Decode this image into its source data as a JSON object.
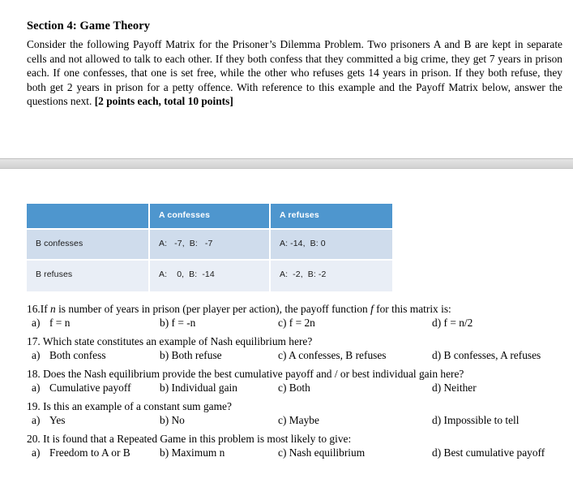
{
  "document": {
    "section_title": "Section 4: Game Theory",
    "intro_paragraph": "Consider the following Payoff Matrix for the Prisoner’s Dilemma Problem. Two prisoners A and B are kept in separate cells and not allowed to talk to each other. If they both confess that they committed a big crime, they get 7 years in prison each. If one confesses, that one is set free, while the other who refuses gets 14 years in prison. If they both refuse, they both get 2 years in prison for a petty offence. With reference to this example and the Payoff Matrix below, answer the questions next. ",
    "intro_bold_tail": "[2 points each, total 10 points]"
  },
  "colors": {
    "table_header_bg": "#4e96ce",
    "table_row_a_bg": "#cfdcec",
    "table_row_b_bg": "#e9eef6",
    "separator_band": "#d2d2d2",
    "text": "#000000"
  },
  "payoff_matrix": {
    "corner_label": "",
    "column_headers": [
      "A  confesses",
      "A refuses"
    ],
    "rows": [
      {
        "row_header": "B confesses",
        "cells": [
          "A:   -7,  B:   -7",
          "A: -14,  B: 0"
        ]
      },
      {
        "row_header": "B refuses",
        "cells": [
          "A:    0,  B:  -14",
          "A:  -2,  B: -2"
        ]
      }
    ]
  },
  "questions": [
    {
      "number": "16.",
      "stem_pre": "If ",
      "stem_italic": "n",
      "stem_mid": " is number of years in prison (per player per action), the payoff function ",
      "stem_italic2": "f",
      "stem_post": " for this matrix is:",
      "options": [
        {
          "label": "a)",
          "text": "f = n"
        },
        {
          "label": "b)",
          "text": "f = -n"
        },
        {
          "label": "c)",
          "text": "f = 2n"
        },
        {
          "label": "d)",
          "text": "f = n/2"
        }
      ]
    },
    {
      "number": "17.",
      "stem": "Which state constitutes an example of Nash equilibrium here?",
      "options": [
        {
          "label": "a)",
          "text": "Both confess"
        },
        {
          "label": "b)",
          "text": "Both refuse"
        },
        {
          "label": "c)",
          "text": "A confesses, B refuses"
        },
        {
          "label": "d)",
          "text": "B confesses, A refuses"
        }
      ]
    },
    {
      "number": "18.",
      "stem": "Does the Nash equilibrium provide the best cumulative payoff and / or best individual gain here?",
      "options": [
        {
          "label": "a)",
          "text": "Cumulative payoff"
        },
        {
          "label": "b)",
          "text": "Individual gain"
        },
        {
          "label": "c)",
          "text": "Both"
        },
        {
          "label": "d)",
          "text": "Neither"
        }
      ]
    },
    {
      "number": "19.",
      "stem": "Is this an example of a constant sum game?",
      "options": [
        {
          "label": "a)",
          "text": "Yes"
        },
        {
          "label": "b)",
          "text": "No"
        },
        {
          "label": "c)",
          "text": "Maybe"
        },
        {
          "label": "d)",
          "text": "Impossible to tell"
        }
      ]
    },
    {
      "number": "20.",
      "stem": "It is found that a Repeated Game in this problem is most likely to give:",
      "options": [
        {
          "label": "a)",
          "text": "Freedom to A or B"
        },
        {
          "label": "b)",
          "text": "Maximum n",
          "italic_tail": "n"
        },
        {
          "label": "c)",
          "text": "Nash equilibrium"
        },
        {
          "label": "d)",
          "text": "Best cumulative payoff"
        }
      ]
    }
  ]
}
